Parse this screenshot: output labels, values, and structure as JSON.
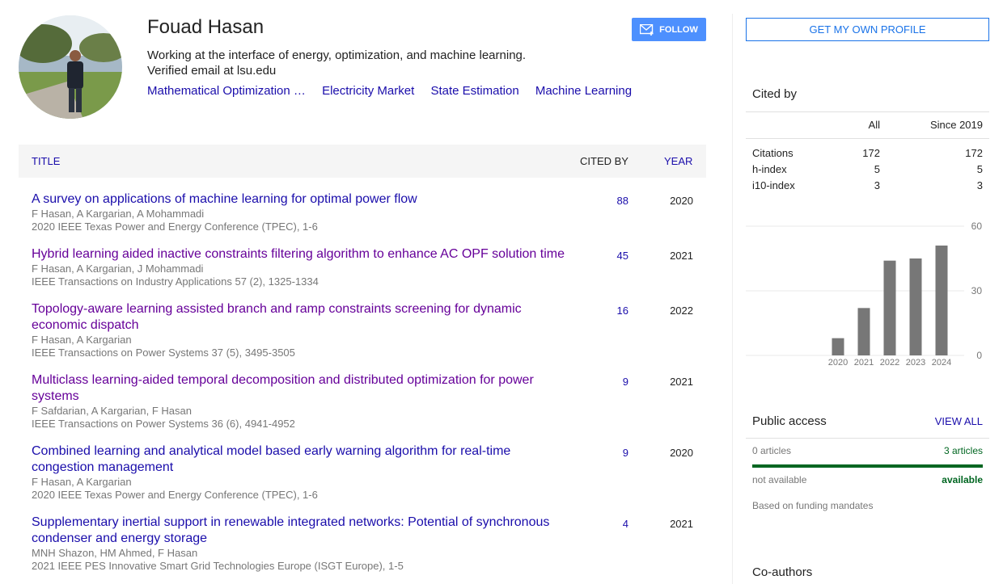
{
  "profile": {
    "name": "Fouad Hasan",
    "affiliation": "Working at the interface of energy, optimization, and machine learning.",
    "email": "Verified email at lsu.edu",
    "interests": [
      "Mathematical Optimization …",
      "Electricity Market",
      "State Estimation",
      "Machine Learning"
    ],
    "follow_label": "FOLLOW"
  },
  "table": {
    "headers": {
      "title": "TITLE",
      "cited_by": "CITED BY",
      "year": "YEAR"
    },
    "rows": [
      {
        "title": "A survey on applications of machine learning for optimal power flow",
        "authors": "F Hasan, A Kargarian, A Mohammadi",
        "venue": "2020 IEEE Texas Power and Energy Conference (TPEC), 1-6",
        "cited": "88",
        "year": "2020",
        "visited": false
      },
      {
        "title": "Hybrid learning aided inactive constraints filtering algorithm to enhance AC OPF solution time",
        "authors": "F Hasan, A Kargarian, J Mohammadi",
        "venue": "IEEE Transactions on Industry Applications 57 (2), 1325-1334",
        "cited": "45",
        "year": "2021",
        "visited": true
      },
      {
        "title": "Topology-aware learning assisted branch and ramp constraints screening for dynamic economic dispatch",
        "authors": "F Hasan, A Kargarian",
        "venue": "IEEE Transactions on Power Systems 37 (5), 3495-3505",
        "cited": "16",
        "year": "2022",
        "visited": true
      },
      {
        "title": "Multiclass learning-aided temporal decomposition and distributed optimization for power systems",
        "authors": "F Safdarian, A Kargarian, F Hasan",
        "venue": "IEEE Transactions on Power Systems 36 (6), 4941-4952",
        "cited": "9",
        "year": "2021",
        "visited": true
      },
      {
        "title": "Combined learning and analytical model based early warning algorithm for real-time congestion management",
        "authors": "F Hasan, A Kargarian",
        "venue": "2020 IEEE Texas Power and Energy Conference (TPEC), 1-6",
        "cited": "9",
        "year": "2020",
        "visited": false
      },
      {
        "title": "Supplementary inertial support in renewable integrated networks: Potential of synchronous condenser and energy storage",
        "authors": "MNH Shazon, HM Ahmed, F Hasan",
        "venue": "2021 IEEE PES Innovative Smart Grid Technologies Europe (ISGT Europe), 1-5",
        "cited": "4",
        "year": "2021",
        "visited": false
      }
    ]
  },
  "sidebar": {
    "own_profile_label": "GET MY OWN PROFILE",
    "cited_by": {
      "title": "Cited by",
      "col_all": "All",
      "col_since": "Since 2019",
      "rows": [
        {
          "label": "Citations",
          "all": "172",
          "since": "172"
        },
        {
          "label": "h-index",
          "all": "5",
          "since": "5"
        },
        {
          "label": "i10-index",
          "all": "3",
          "since": "3"
        }
      ]
    },
    "public_access": {
      "title": "Public access",
      "view_all": "VIEW ALL",
      "left_count": "0 articles",
      "right_count": "3 articles",
      "left_status": "not available",
      "right_status": "available",
      "note": "Based on funding mandates",
      "available_fraction": 1.0,
      "bar_color": "#006621"
    },
    "coauthors_title": "Co-authors"
  },
  "chart_data": {
    "type": "bar",
    "categories": [
      "2020",
      "2021",
      "2022",
      "2023",
      "2024"
    ],
    "values": [
      8,
      22,
      44,
      45,
      51
    ],
    "ylim": [
      0,
      60
    ],
    "yticks": [
      "60",
      "30",
      "0"
    ],
    "grid": true,
    "bar_color": "#777777"
  }
}
